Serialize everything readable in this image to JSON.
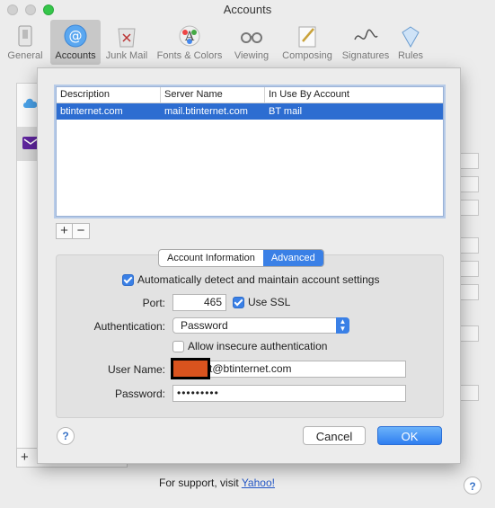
{
  "window": {
    "title": "Accounts"
  },
  "toolbar": {
    "items": [
      {
        "label": "General",
        "icon": "general-icon"
      },
      {
        "label": "Accounts",
        "icon": "accounts-icon",
        "active": true
      },
      {
        "label": "Junk Mail",
        "icon": "junk-mail-icon"
      },
      {
        "label": "Fonts & Colors",
        "icon": "fonts-colors-icon"
      },
      {
        "label": "Viewing",
        "icon": "viewing-icon"
      },
      {
        "label": "Composing",
        "icon": "composing-icon"
      },
      {
        "label": "Signatures",
        "icon": "signatures-icon"
      },
      {
        "label": "Rules",
        "icon": "rules-icon"
      }
    ]
  },
  "table": {
    "headers": [
      "Description",
      "Server Name",
      "In Use By Account"
    ],
    "rows": [
      [
        "btinternet.com",
        "mail.btinternet.com",
        "BT mail"
      ]
    ]
  },
  "list_buttons": {
    "add": "+",
    "remove": "−"
  },
  "tabs": {
    "account_info": "Account Information",
    "advanced": "Advanced"
  },
  "form": {
    "auto_detect_label": "Automatically detect and maintain account settings",
    "port_label": "Port:",
    "port_value": "465",
    "use_ssl_label": "Use SSL",
    "authentication_label": "Authentication:",
    "authentication_value": "Password",
    "allow_insecure_label": "Allow insecure authentication",
    "username_label": "User Name:",
    "username_value": "t@btinternet.com",
    "password_label": "Password:",
    "password_value": "•••••••••"
  },
  "buttons": {
    "help": "?",
    "cancel": "Cancel",
    "ok": "OK"
  },
  "background": {
    "add_account": "+",
    "support_prefix": "For support, visit ",
    "support_link": "Yahoo!",
    "help": "?"
  },
  "colors": {
    "accent": "#3a80e6",
    "selection": "#2d6dd1",
    "redaction": "#d9531e"
  }
}
